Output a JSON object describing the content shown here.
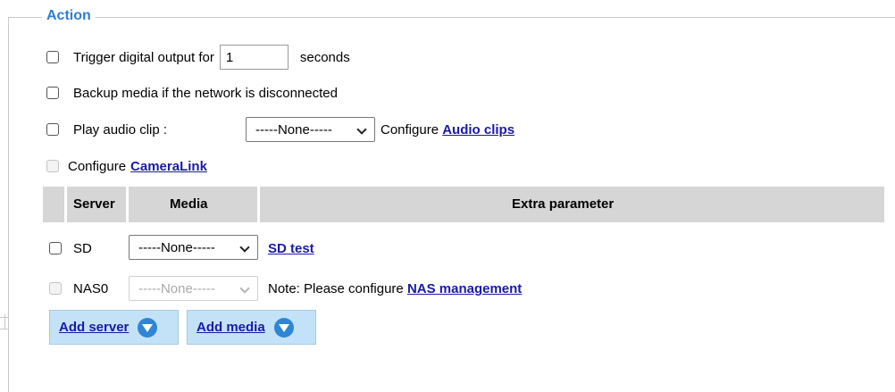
{
  "section": {
    "title": "Action"
  },
  "options": {
    "trigger_output": {
      "label": "Trigger digital output for",
      "value": "1",
      "unit": "seconds",
      "checked": false
    },
    "backup_media": {
      "label": "Backup media if the network is disconnected",
      "checked": false
    },
    "play_audio": {
      "label": "Play audio clip :",
      "selected": "-----None-----",
      "configure_text": "Configure",
      "configure_link": "Audio clips",
      "checked": false
    },
    "camera_link": {
      "configure_text": "Configure",
      "configure_link": "CameraLink",
      "disabled": true
    }
  },
  "table": {
    "headers": [
      "Server",
      "Media",
      "Extra parameter"
    ],
    "rows": [
      {
        "server": "SD",
        "media": "-----None-----",
        "extra_link": "SD test",
        "disabled": false
      },
      {
        "server": "NAS0",
        "media": "-----None-----",
        "extra_note": "Note: Please configure",
        "extra_link": "NAS management",
        "disabled": true
      }
    ]
  },
  "buttons": {
    "add_server": "Add server",
    "add_media": "Add media"
  },
  "colors": {
    "title": "#2f7fd0",
    "link": "#1a1aa6",
    "header_bg": "#d6d6d6",
    "button_bg": "#c4e2f7",
    "button_icon": "#2e86d4"
  },
  "icons": {
    "add_server": "chevron-down-circle-icon",
    "add_media": "chevron-down-circle-icon"
  }
}
